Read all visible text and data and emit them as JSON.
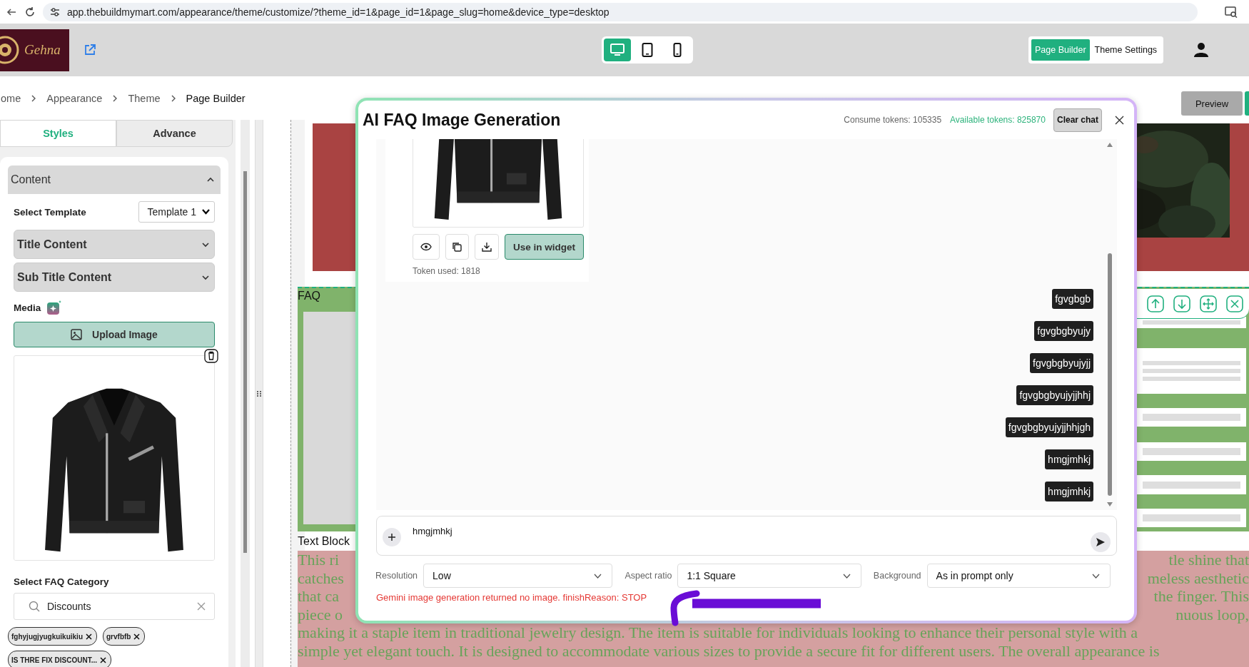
{
  "browser": {
    "url": "app.thebuildmymart.com/appearance/theme/customize/?theme_id=1&page_id=1&page_slug=home&device_type=desktop"
  },
  "header": {
    "logo_text": "Gehna",
    "devices": [
      {
        "kind": "desktop",
        "selected": true
      },
      {
        "kind": "tablet",
        "selected": false
      },
      {
        "kind": "mobile",
        "selected": false
      }
    ],
    "modes": [
      {
        "label": "Page Builder",
        "selected": true
      },
      {
        "label": "Theme Settings",
        "selected": false
      }
    ]
  },
  "breadcrumb": [
    "ome",
    "Appearance",
    "Theme",
    "Page Builder"
  ],
  "preview_button": "Preview",
  "sidebar": {
    "tabs": [
      {
        "label": "Styles",
        "selected": true
      },
      {
        "label": "Advance",
        "selected": false
      }
    ],
    "section": {
      "title": "Content",
      "expanded": true
    },
    "template": {
      "label": "Select Template",
      "value": "Template 1"
    },
    "groups": [
      {
        "title": "Title Content",
        "expanded": false
      },
      {
        "title": "Sub Title Content",
        "expanded": false
      }
    ],
    "media": {
      "label": "Media",
      "upload_button": "Upload Image"
    },
    "faq_category": {
      "label": "Select FAQ Category",
      "search": "Discounts",
      "tags": [
        "fghyjugjyugkuikuikiu",
        "grvfbfb",
        "IS THRE FIX DISCOUNT..."
      ]
    }
  },
  "canvas": {
    "faq_label": "FAQ",
    "text_block_label": "Text Block",
    "lines": [
      {
        "left": "This ri",
        "right": "tle shine that"
      },
      {
        "left": "catches",
        "right": "meless aesthetic"
      },
      {
        "left": "that ca",
        "right": "the finger. This"
      },
      {
        "left": "piece o",
        "right": "nuous loop,"
      },
      {
        "text": "making it a staple item in traditional jewelry design. The item is suitable for individuals looking to enhance their personal style with a"
      },
      {
        "text": "simple yet elegant touch. It is designed to accommodate various sizes to provide a secure fit for different users. The overall appearance is"
      }
    ]
  },
  "modal": {
    "title": "AI FAQ Image Generation",
    "consume_tokens": "Consume tokens: 105335",
    "available_tokens": "Available tokens: 825870",
    "clear_button": "Clear chat",
    "result": {
      "action_button": "Use in widget",
      "tokens": "Token used: 1818"
    },
    "messages": [
      "fgvgbgb",
      "fgvgbgbyujy",
      "fgvgbgbyujyjj",
      "fgvgbgbyujyjjhhj",
      "fgvgbgbyujyjjhhjgh",
      "hmgjmhkj",
      "hmgjmhkj"
    ],
    "prompt": "hmgjmhkj",
    "settings": [
      {
        "label": "Resolution",
        "value": "Low"
      },
      {
        "label": "Aspect ratio",
        "value": "1:1 Square"
      },
      {
        "label": "Background",
        "value": "As in prompt only"
      }
    ],
    "error": "Gemini image generation returned no image. finishReason: STOP"
  }
}
